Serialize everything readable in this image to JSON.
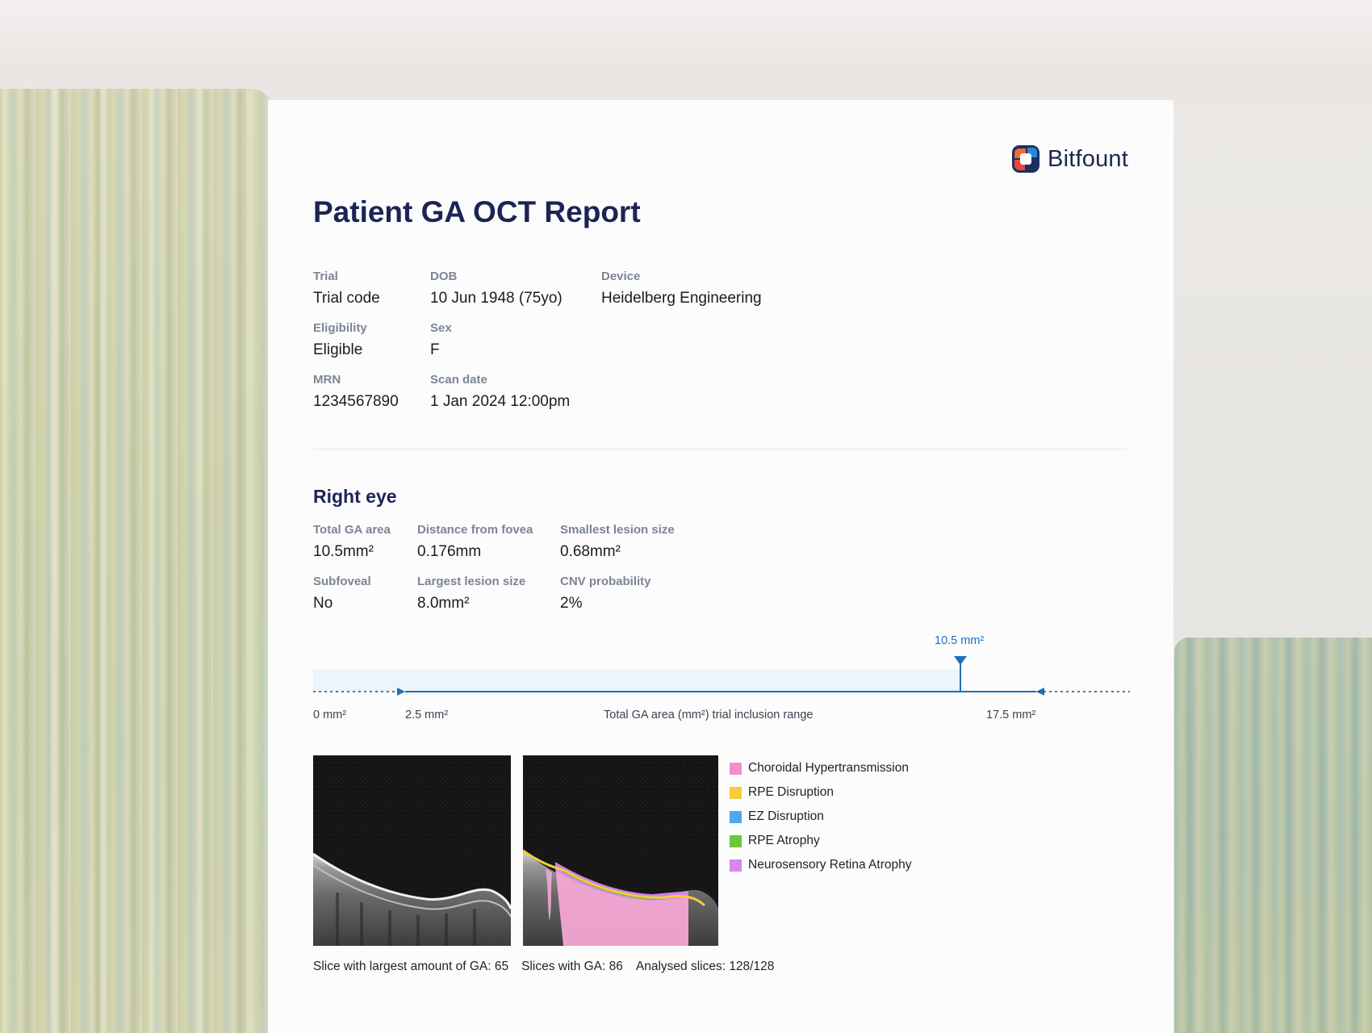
{
  "brand": {
    "name": "Bitfount"
  },
  "report": {
    "title": "Patient GA OCT Report"
  },
  "patient": {
    "trial_label": "Trial",
    "trial_value": "Trial code",
    "dob_label": "DOB",
    "dob_value": "10 Jun 1948 (75yo)",
    "device_label": "Device",
    "device_value": "Heidelberg Engineering",
    "eligibility_label": "Eligibility",
    "eligibility_value": "Eligible",
    "sex_label": "Sex",
    "sex_value": "F",
    "mrn_label": "MRN",
    "mrn_value": "1234567890",
    "scan_date_label": "Scan date",
    "scan_date_value": "1 Jan 2024 12:00pm"
  },
  "right_eye": {
    "heading": "Right eye",
    "total_ga_label": "Total GA area",
    "total_ga_value": "10.5mm²",
    "distance_label": "Distance from fovea",
    "distance_value": "0.176mm",
    "smallest_label": "Smallest lesion size",
    "smallest_value": "0.68mm²",
    "subfoveal_label": "Subfoveal",
    "subfoveal_value": "No",
    "largest_label": "Largest lesion size",
    "largest_value": "8.0mm²",
    "cnv_label": "CNV probability",
    "cnv_value": "2%"
  },
  "range": {
    "marker_label": "10.5 mm²",
    "min_label": "0 mm²",
    "low_label": "2.5 mm²",
    "axis_label": "Total GA area (mm²) trial inclusion range",
    "high_label": "17.5 mm²",
    "axis_min": 0,
    "trial_min": 2.5,
    "trial_max": 17.5,
    "value": 10.5,
    "axis_max": 20.5
  },
  "legend": [
    {
      "label": "Choroidal Hypertransmission",
      "color": "#f28fc7"
    },
    {
      "label": "RPE Disruption",
      "color": "#f6cd3a"
    },
    {
      "label": "EZ Disruption",
      "color": "#4fa8ee"
    },
    {
      "label": "RPE Atrophy",
      "color": "#6fc63b"
    },
    {
      "label": "Neurosensory Retina Atrophy",
      "color": "#d987ec"
    }
  ],
  "stats": {
    "largest_slice": "Slice with largest amount of GA: 65",
    "slices_with_ga": "Slices with GA: 86",
    "analysed": "Analysed slices: 128/128"
  },
  "colors": {
    "accent": "#1f6fb7",
    "title": "#1c2455",
    "label": "#7c8594"
  }
}
